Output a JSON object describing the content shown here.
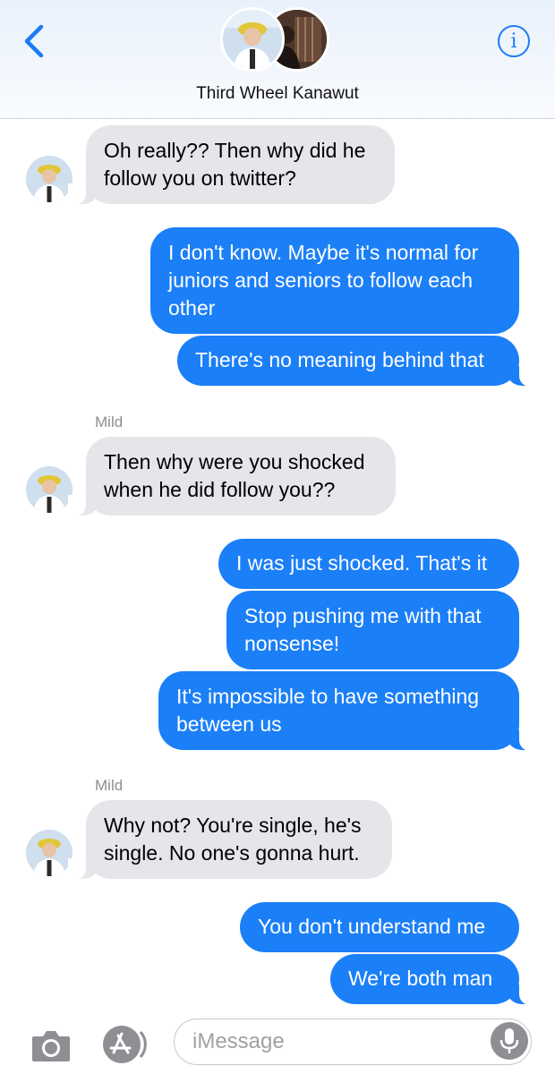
{
  "header": {
    "title": "Third Wheel Kanawut",
    "back_icon": "chevron-left-icon",
    "info_label": "i",
    "info_icon": "info-icon"
  },
  "colors": {
    "accent": "#1a7cf5",
    "outgoing_bubble": "#1b7ff7",
    "incoming_bubble": "#e5e5ea"
  },
  "messages": [
    {
      "direction": "in",
      "sender": "",
      "text": "Oh really?? Then why did he follow you on twitter?"
    },
    {
      "direction": "out",
      "text": "I don't know. Maybe it's normal for juniors and seniors to follow each other"
    },
    {
      "direction": "out",
      "text": "There's no meaning behind that"
    },
    {
      "direction": "in",
      "sender": "Mild",
      "text": "Then why were you shocked when he did follow you??"
    },
    {
      "direction": "out",
      "text": "I was just shocked. That's it"
    },
    {
      "direction": "out",
      "text": "Stop pushing me with that nonsense!"
    },
    {
      "direction": "out",
      "text": "It's impossible to have something between us"
    },
    {
      "direction": "in",
      "sender": "Mild",
      "text": "Why not? You're single, he's single. No one's gonna hurt."
    },
    {
      "direction": "out",
      "text": "You don't understand me"
    },
    {
      "direction": "out",
      "text": "We're both man"
    }
  ],
  "composer": {
    "placeholder": "iMessage",
    "camera_icon": "camera-icon",
    "apps_icon": "app-store-icon",
    "mic_icon": "microphone-icon"
  }
}
